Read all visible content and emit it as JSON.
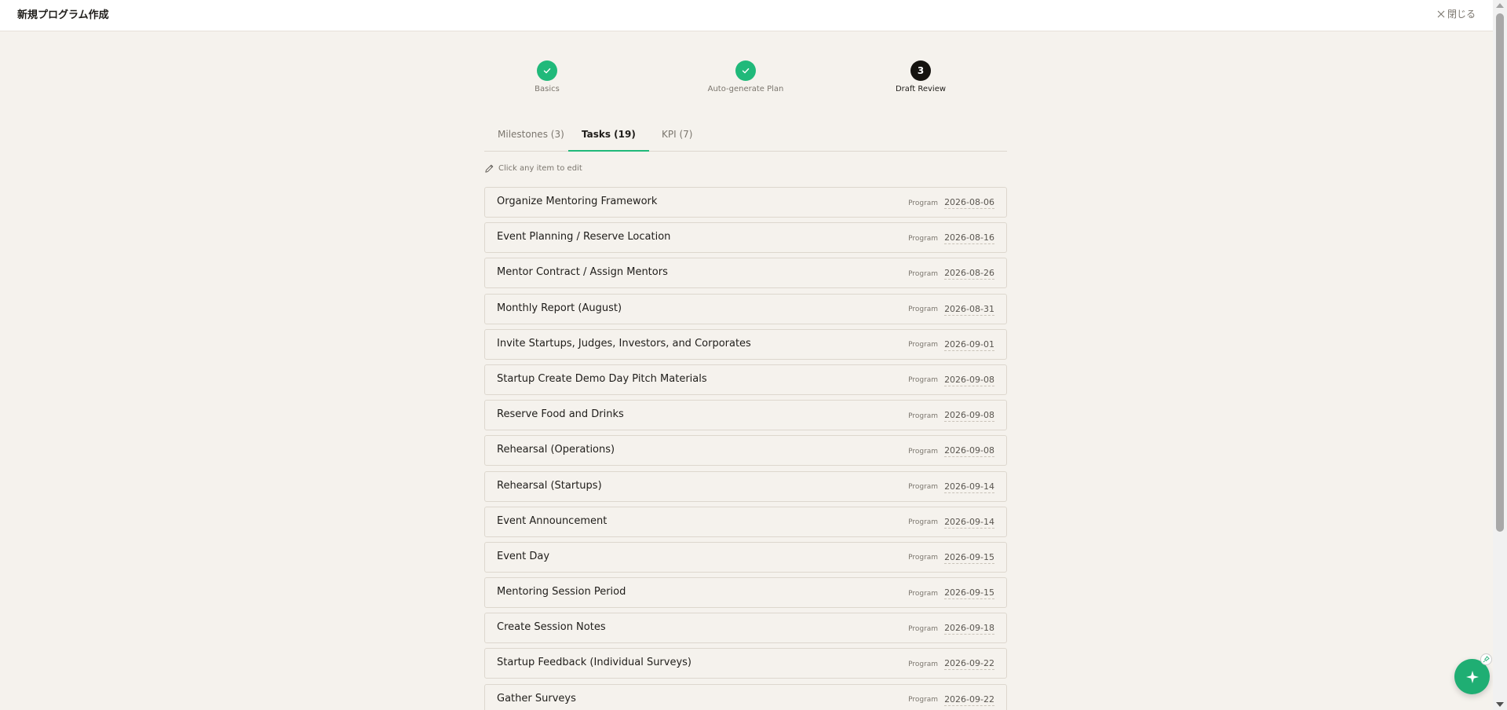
{
  "header": {
    "title": "新規プログラム作成",
    "close_label": "閉じる"
  },
  "stepper": {
    "steps": [
      {
        "number": "1",
        "label": "Basics",
        "status": "done"
      },
      {
        "number": "2",
        "label": "Auto-generate Plan",
        "status": "done"
      },
      {
        "number": "3",
        "label": "Draft Review",
        "status": "current"
      }
    ]
  },
  "tabs": [
    {
      "label": "Milestones (3)",
      "active": false
    },
    {
      "label": "Tasks (19)",
      "active": true
    },
    {
      "label": "KPI (7)",
      "active": false
    }
  ],
  "hint": "Click any item to edit",
  "tasks": [
    {
      "name": "Organize Mentoring Framework",
      "type": "Program",
      "date": "2026-08-06"
    },
    {
      "name": "Event Planning / Reserve Location",
      "type": "Program",
      "date": "2026-08-16"
    },
    {
      "name": "Mentor Contract / Assign Mentors",
      "type": "Program",
      "date": "2026-08-26"
    },
    {
      "name": "Monthly Report (August)",
      "type": "Program",
      "date": "2026-08-31"
    },
    {
      "name": "Invite Startups, Judges, Investors, and Corporates",
      "type": "Program",
      "date": "2026-09-01"
    },
    {
      "name": "Startup Create Demo Day Pitch Materials",
      "type": "Program",
      "date": "2026-09-08"
    },
    {
      "name": "Reserve Food and Drinks",
      "type": "Program",
      "date": "2026-09-08"
    },
    {
      "name": "Rehearsal (Operations)",
      "type": "Program",
      "date": "2026-09-08"
    },
    {
      "name": "Rehearsal (Startups)",
      "type": "Program",
      "date": "2026-09-14"
    },
    {
      "name": "Event Announcement",
      "type": "Program",
      "date": "2026-09-14"
    },
    {
      "name": "Event Day",
      "type": "Program",
      "date": "2026-09-15"
    },
    {
      "name": "Mentoring Session Period",
      "type": "Program",
      "date": "2026-09-15"
    },
    {
      "name": "Create Session Notes",
      "type": "Program",
      "date": "2026-09-18"
    },
    {
      "name": "Startup Feedback (Individual Surveys)",
      "type": "Program",
      "date": "2026-09-22"
    },
    {
      "name": "Gather Surveys",
      "type": "Program",
      "date": "2026-09-22"
    }
  ],
  "colors": {
    "accent": "#20b97a",
    "background": "#f5f2ed",
    "current_step": "#15130f"
  },
  "icons": {
    "close": "close-icon",
    "check": "check-icon",
    "pencil": "pencil-icon",
    "sparkle": "sparkle-icon",
    "pin": "pin-icon"
  }
}
